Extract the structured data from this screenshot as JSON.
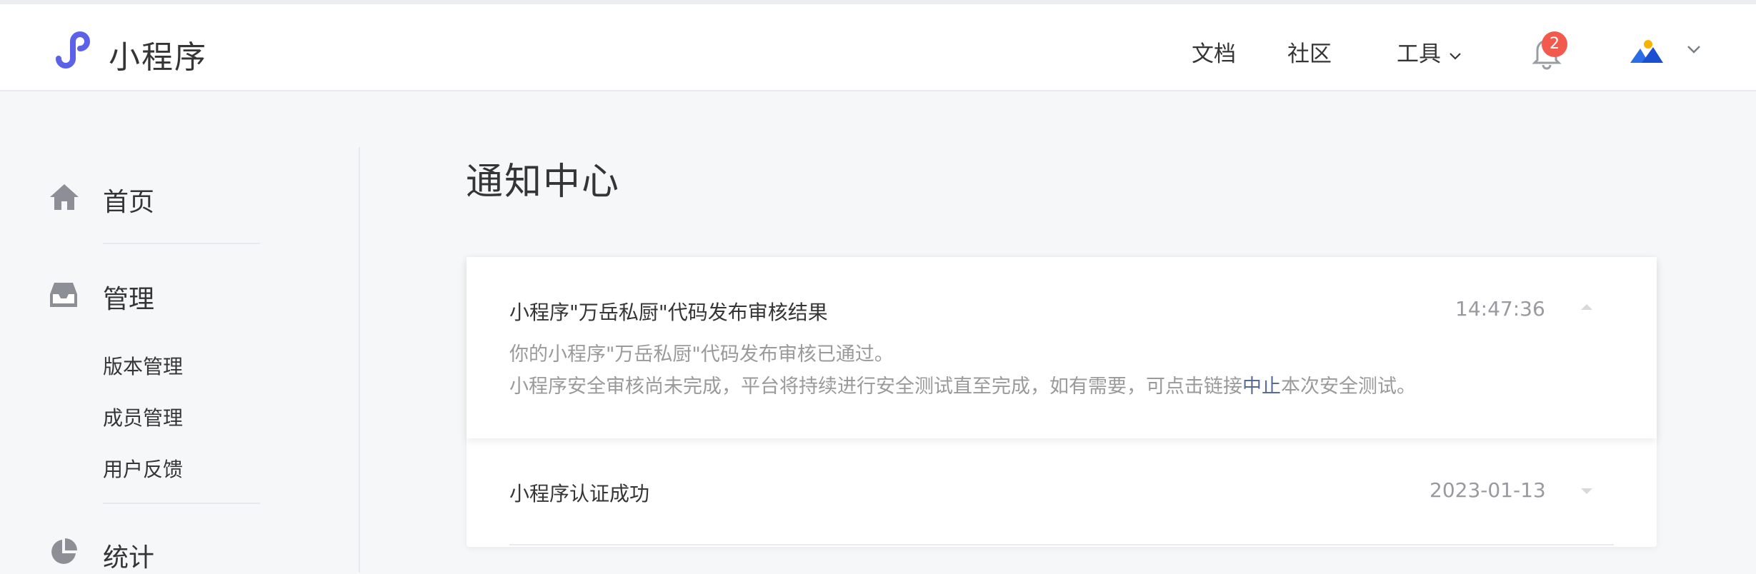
{
  "header": {
    "logo_text": "小程序",
    "nav": {
      "docs": "文档",
      "community": "社区",
      "tools": "工具"
    },
    "notification_count": "2"
  },
  "sidebar": {
    "home": "首页",
    "manage": "管理",
    "manage_items": [
      "版本管理",
      "成员管理",
      "用户反馈"
    ],
    "stats": "统计"
  },
  "main": {
    "title": "通知中心",
    "notices": [
      {
        "title": "小程序\"万岳私厨\"代码发布审核结果",
        "time": "14:47:36",
        "body_line1": "你的小程序\"万岳私厨\"代码发布审核已通过。",
        "body_line2_pre": "小程序安全审核尚未完成，平台将持续进行安全测试直至完成，如有需要，可点击链接",
        "body_line2_link": "中止",
        "body_line2_post": "本次安全测试。"
      },
      {
        "title": "小程序认证成功",
        "time": "2023-01-13"
      }
    ]
  },
  "colors": {
    "accent": "#576b95",
    "badge": "#f25a4e",
    "logo": "#5b61e8"
  }
}
